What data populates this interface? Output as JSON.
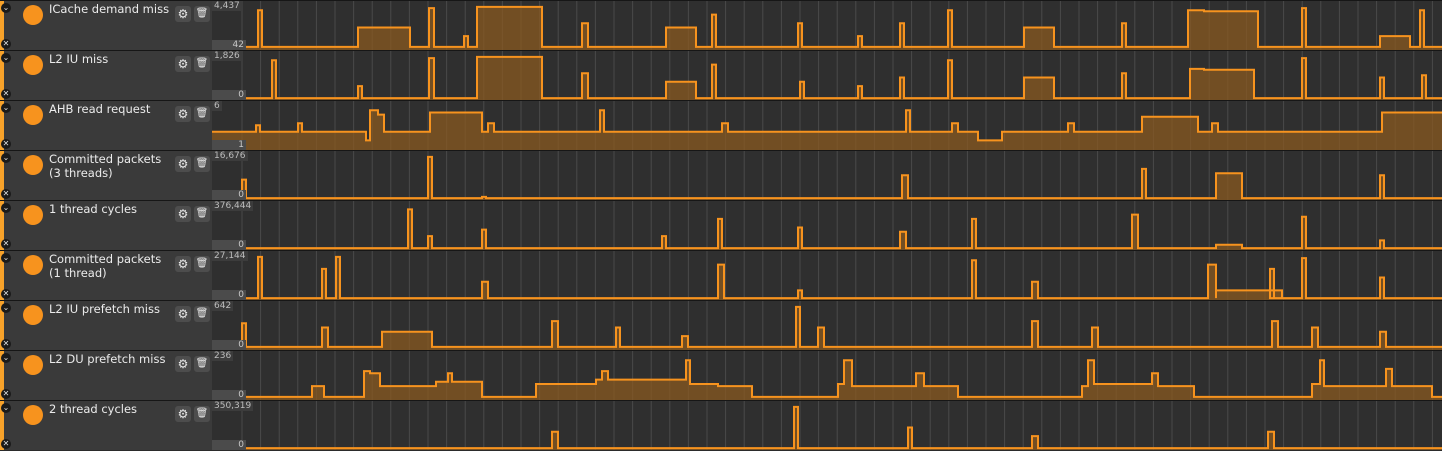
{
  "colors": {
    "accent": "#f7931e",
    "fill": "#8a5a20",
    "grid": "#4a4a4a",
    "panel": "#3a3a3a",
    "plot_bg": "#2f2f2f"
  },
  "icons": {
    "collapse": "chevron-down-icon",
    "remove": "close-icon",
    "settings": "gear-icon",
    "delete": "trash-icon"
  },
  "tracks": [
    {
      "name": "ICache demand miss",
      "max_label": "4,437",
      "min_label": "42",
      "steps": [
        [
          0,
          0.05
        ],
        [
          46,
          0.9
        ],
        [
          50,
          0.05
        ],
        [
          146,
          0.5
        ],
        [
          198,
          0.05
        ],
        [
          217,
          0.95
        ],
        [
          222,
          0.05
        ],
        [
          252,
          0.3
        ],
        [
          256,
          0.05
        ],
        [
          265,
          0.98
        ],
        [
          330,
          0.05
        ],
        [
          370,
          0.6
        ],
        [
          376,
          0.05
        ],
        [
          454,
          0.5
        ],
        [
          484,
          0.05
        ],
        [
          500,
          0.8
        ],
        [
          504,
          0.05
        ],
        [
          586,
          0.6
        ],
        [
          590,
          0.05
        ],
        [
          646,
          0.3
        ],
        [
          650,
          0.05
        ],
        [
          688,
          0.6
        ],
        [
          692,
          0.05
        ],
        [
          736,
          0.9
        ],
        [
          740,
          0.05
        ],
        [
          812,
          0.5
        ],
        [
          842,
          0.05
        ],
        [
          910,
          0.6
        ],
        [
          914,
          0.05
        ],
        [
          976,
          0.9
        ],
        [
          992,
          0.88
        ],
        [
          1046,
          0.05
        ],
        [
          1090,
          0.95
        ],
        [
          1094,
          0.05
        ],
        [
          1168,
          0.3
        ],
        [
          1198,
          0.05
        ],
        [
          1208,
          0.9
        ],
        [
          1212,
          0.05
        ],
        [
          1230,
          0.05
        ]
      ]
    },
    {
      "name": "L2 IU miss",
      "max_label": "1,826",
      "min_label": "0",
      "steps": [
        [
          0,
          0.02
        ],
        [
          60,
          0.9
        ],
        [
          64,
          0.02
        ],
        [
          146,
          0.3
        ],
        [
          150,
          0.02
        ],
        [
          217,
          0.95
        ],
        [
          222,
          0.02
        ],
        [
          265,
          0.98
        ],
        [
          330,
          0.02
        ],
        [
          370,
          0.6
        ],
        [
          376,
          0.02
        ],
        [
          454,
          0.4
        ],
        [
          484,
          0.02
        ],
        [
          500,
          0.8
        ],
        [
          504,
          0.02
        ],
        [
          588,
          0.4
        ],
        [
          592,
          0.02
        ],
        [
          646,
          0.3
        ],
        [
          650,
          0.02
        ],
        [
          688,
          0.5
        ],
        [
          692,
          0.02
        ],
        [
          736,
          0.9
        ],
        [
          740,
          0.02
        ],
        [
          812,
          0.5
        ],
        [
          842,
          0.02
        ],
        [
          910,
          0.6
        ],
        [
          914,
          0.02
        ],
        [
          978,
          0.7
        ],
        [
          992,
          0.68
        ],
        [
          1042,
          0.02
        ],
        [
          1090,
          0.95
        ],
        [
          1094,
          0.02
        ],
        [
          1168,
          0.5
        ],
        [
          1172,
          0.02
        ],
        [
          1210,
          0.55
        ],
        [
          1214,
          0.02
        ],
        [
          1230,
          0.02
        ]
      ]
    },
    {
      "name": "AHB read request",
      "max_label": "6",
      "min_label": "1",
      "steps": [
        [
          0,
          0.4
        ],
        [
          44,
          0.55
        ],
        [
          48,
          0.4
        ],
        [
          86,
          0.6
        ],
        [
          90,
          0.4
        ],
        [
          154,
          0.2
        ],
        [
          158,
          0.9
        ],
        [
          166,
          0.8
        ],
        [
          172,
          0.4
        ],
        [
          200,
          0.4
        ],
        [
          218,
          0.85
        ],
        [
          270,
          0.4
        ],
        [
          276,
          0.6
        ],
        [
          282,
          0.4
        ],
        [
          310,
          0.4
        ],
        [
          330,
          0.4
        ],
        [
          388,
          0.9
        ],
        [
          392,
          0.4
        ],
        [
          450,
          0.4
        ],
        [
          510,
          0.6
        ],
        [
          516,
          0.4
        ],
        [
          570,
          0.4
        ],
        [
          650,
          0.4
        ],
        [
          694,
          0.9
        ],
        [
          698,
          0.4
        ],
        [
          740,
          0.6
        ],
        [
          746,
          0.4
        ],
        [
          766,
          0.2
        ],
        [
          790,
          0.4
        ],
        [
          856,
          0.6
        ],
        [
          862,
          0.4
        ],
        [
          900,
          0.4
        ],
        [
          930,
          0.75
        ],
        [
          986,
          0.4
        ],
        [
          1000,
          0.6
        ],
        [
          1006,
          0.4
        ],
        [
          1030,
          0.4
        ],
        [
          1100,
          0.4
        ],
        [
          1170,
          0.85
        ],
        [
          1230,
          0.85
        ]
      ]
    },
    {
      "name": "Committed packets\n(3 threads)",
      "max_label": "16,676",
      "min_label": "0",
      "steps": [
        [
          0,
          0.02
        ],
        [
          30,
          0.45
        ],
        [
          34,
          0.02
        ],
        [
          216,
          0.98
        ],
        [
          220,
          0.02
        ],
        [
          270,
          0.05
        ],
        [
          274,
          0.02
        ],
        [
          690,
          0.55
        ],
        [
          696,
          0.02
        ],
        [
          930,
          0.7
        ],
        [
          934,
          0.02
        ],
        [
          1004,
          0.6
        ],
        [
          1030,
          0.02
        ],
        [
          1168,
          0.55
        ],
        [
          1172,
          0.02
        ],
        [
          1230,
          0.02
        ]
      ]
    },
    {
      "name": "1 thread cycles",
      "max_label": "376,444",
      "min_label": "0",
      "steps": [
        [
          0,
          0.02
        ],
        [
          196,
          0.92
        ],
        [
          200,
          0.02
        ],
        [
          216,
          0.3
        ],
        [
          220,
          0.02
        ],
        [
          270,
          0.45
        ],
        [
          274,
          0.02
        ],
        [
          450,
          0.3
        ],
        [
          454,
          0.02
        ],
        [
          506,
          0.7
        ],
        [
          510,
          0.02
        ],
        [
          586,
          0.5
        ],
        [
          590,
          0.02
        ],
        [
          688,
          0.4
        ],
        [
          694,
          0.02
        ],
        [
          760,
          0.7
        ],
        [
          764,
          0.02
        ],
        [
          920,
          0.8
        ],
        [
          926,
          0.02
        ],
        [
          1004,
          0.1
        ],
        [
          1030,
          0.02
        ],
        [
          1090,
          0.75
        ],
        [
          1094,
          0.02
        ],
        [
          1168,
          0.2
        ],
        [
          1172,
          0.02
        ],
        [
          1230,
          0.02
        ]
      ]
    },
    {
      "name": "Committed packets\n(1 thread)",
      "max_label": "27,144",
      "min_label": "0",
      "steps": [
        [
          0,
          0.02
        ],
        [
          46,
          0.98
        ],
        [
          50,
          0.02
        ],
        [
          110,
          0.7
        ],
        [
          114,
          0.02
        ],
        [
          124,
          0.98
        ],
        [
          128,
          0.02
        ],
        [
          270,
          0.4
        ],
        [
          276,
          0.02
        ],
        [
          506,
          0.8
        ],
        [
          512,
          0.02
        ],
        [
          586,
          0.2
        ],
        [
          590,
          0.02
        ],
        [
          760,
          0.9
        ],
        [
          764,
          0.02
        ],
        [
          820,
          0.4
        ],
        [
          826,
          0.02
        ],
        [
          996,
          0.8
        ],
        [
          1004,
          0.02
        ],
        [
          1004,
          0.2
        ],
        [
          1070,
          0.02
        ],
        [
          1058,
          0.7
        ],
        [
          1062,
          0.02
        ],
        [
          1090,
          0.95
        ],
        [
          1094,
          0.02
        ],
        [
          1168,
          0.5
        ],
        [
          1172,
          0.02
        ],
        [
          1230,
          0.02
        ]
      ]
    },
    {
      "name": "L2 IU prefetch miss",
      "max_label": "642",
      "min_label": "0",
      "steps": [
        [
          0,
          0.05
        ],
        [
          30,
          0.6
        ],
        [
          34,
          0.05
        ],
        [
          110,
          0.5
        ],
        [
          116,
          0.05
        ],
        [
          170,
          0.4
        ],
        [
          220,
          0.05
        ],
        [
          340,
          0.65
        ],
        [
          346,
          0.05
        ],
        [
          404,
          0.5
        ],
        [
          408,
          0.05
        ],
        [
          470,
          0.3
        ],
        [
          476,
          0.05
        ],
        [
          584,
          0.98
        ],
        [
          588,
          0.05
        ],
        [
          606,
          0.5
        ],
        [
          612,
          0.05
        ],
        [
          820,
          0.65
        ],
        [
          826,
          0.05
        ],
        [
          880,
          0.5
        ],
        [
          886,
          0.05
        ],
        [
          1060,
          0.65
        ],
        [
          1066,
          0.05
        ],
        [
          1100,
          0.5
        ],
        [
          1106,
          0.05
        ],
        [
          1168,
          0.4
        ],
        [
          1174,
          0.05
        ],
        [
          1230,
          0.05
        ]
      ]
    },
    {
      "name": "L2 DU prefetch miss",
      "max_label": "236",
      "min_label": "0",
      "steps": [
        [
          0,
          0.05
        ],
        [
          100,
          0.3
        ],
        [
          112,
          0.05
        ],
        [
          152,
          0.65
        ],
        [
          158,
          0.6
        ],
        [
          168,
          0.3
        ],
        [
          224,
          0.4
        ],
        [
          236,
          0.6
        ],
        [
          240,
          0.4
        ],
        [
          270,
          0.05
        ],
        [
          310,
          0.05
        ],
        [
          324,
          0.35
        ],
        [
          384,
          0.45
        ],
        [
          390,
          0.65
        ],
        [
          396,
          0.45
        ],
        [
          474,
          0.9
        ],
        [
          478,
          0.35
        ],
        [
          506,
          0.3
        ],
        [
          540,
          0.05
        ],
        [
          620,
          0.05
        ],
        [
          626,
          0.35
        ],
        [
          632,
          0.9
        ],
        [
          640,
          0.3
        ],
        [
          704,
          0.6
        ],
        [
          712,
          0.3
        ],
        [
          746,
          0.05
        ],
        [
          870,
          0.3
        ],
        [
          876,
          0.9
        ],
        [
          882,
          0.35
        ],
        [
          940,
          0.6
        ],
        [
          946,
          0.3
        ],
        [
          982,
          0.05
        ],
        [
          1100,
          0.35
        ],
        [
          1108,
          0.9
        ],
        [
          1112,
          0.3
        ],
        [
          1174,
          0.7
        ],
        [
          1180,
          0.3
        ],
        [
          1220,
          0.05
        ],
        [
          1230,
          0.05
        ]
      ]
    },
    {
      "name": "2 thread cycles",
      "max_label": "350,319",
      "min_label": "0",
      "steps": [
        [
          0,
          0.02
        ],
        [
          340,
          0.4
        ],
        [
          346,
          0.02
        ],
        [
          582,
          0.98
        ],
        [
          586,
          0.02
        ],
        [
          696,
          0.5
        ],
        [
          700,
          0.02
        ],
        [
          820,
          0.3
        ],
        [
          826,
          0.02
        ],
        [
          1056,
          0.4
        ],
        [
          1062,
          0.02
        ],
        [
          1230,
          0.02
        ]
      ]
    }
  ]
}
